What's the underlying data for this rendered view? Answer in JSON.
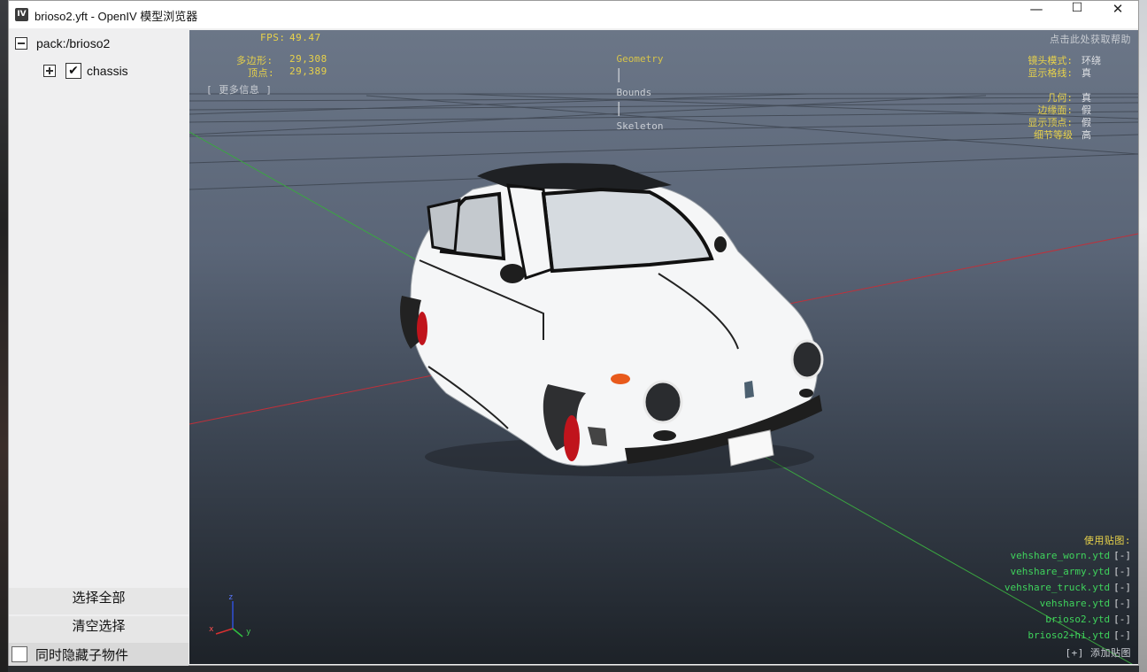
{
  "window": {
    "icon_text": "IV",
    "title": "brioso2.yft - OpenIV 模型浏览器",
    "minimize": "—",
    "maximize": "☐",
    "close": "✕"
  },
  "tree": {
    "root_label": "pack:/brioso2",
    "child_label": "chassis",
    "child_checked": true,
    "check_glyph": "✔"
  },
  "panel_buttons": {
    "select_all": "选择全部",
    "clear_selection": "清空选择",
    "hide_children": "同时隐藏子物件"
  },
  "viewport": {
    "fps_label": "FPS:",
    "fps_value": "49.47",
    "polygons_label": "多边形:",
    "polygons_value": "29,308",
    "vertices_label": "顶点:",
    "vertices_value": "29,389",
    "more_info": "[ 更多信息 ]",
    "tabs": [
      "Geometry",
      "Bounds",
      "Skeleton"
    ],
    "tab_separator": "|",
    "active_tab": "Geometry",
    "help": "点击此处获取帮助",
    "settings": [
      {
        "label": "镜头模式:",
        "value": "环绕"
      },
      {
        "label": "显示格线:",
        "value": "真"
      }
    ],
    "display": [
      {
        "label": "几何:",
        "value": "真"
      },
      {
        "label": "边缘面:",
        "value": "假"
      },
      {
        "label": "显示顶点:",
        "value": "假"
      },
      {
        "label": "细节等级",
        "value": "高"
      }
    ],
    "textures_title": "使用贴图:",
    "textures": [
      "vehshare_worn.ytd",
      "vehshare_army.ytd",
      "vehshare_truck.ytd",
      "vehshare.ytd",
      "brioso2.ytd",
      "brioso2+hi.ytd"
    ],
    "remove_glyph": "[-]",
    "add_texture": "[+] 添加贴图",
    "axis": {
      "x": "x",
      "y": "y",
      "z": "z"
    },
    "colors": {
      "overlay_yellow": "#e8d24a",
      "texture_green": "#3fd35c",
      "axis_red": "#c0303a",
      "axis_green": "#3aa640",
      "car_body": "#f5f6f7",
      "wheel_red": "#c0141c"
    }
  }
}
